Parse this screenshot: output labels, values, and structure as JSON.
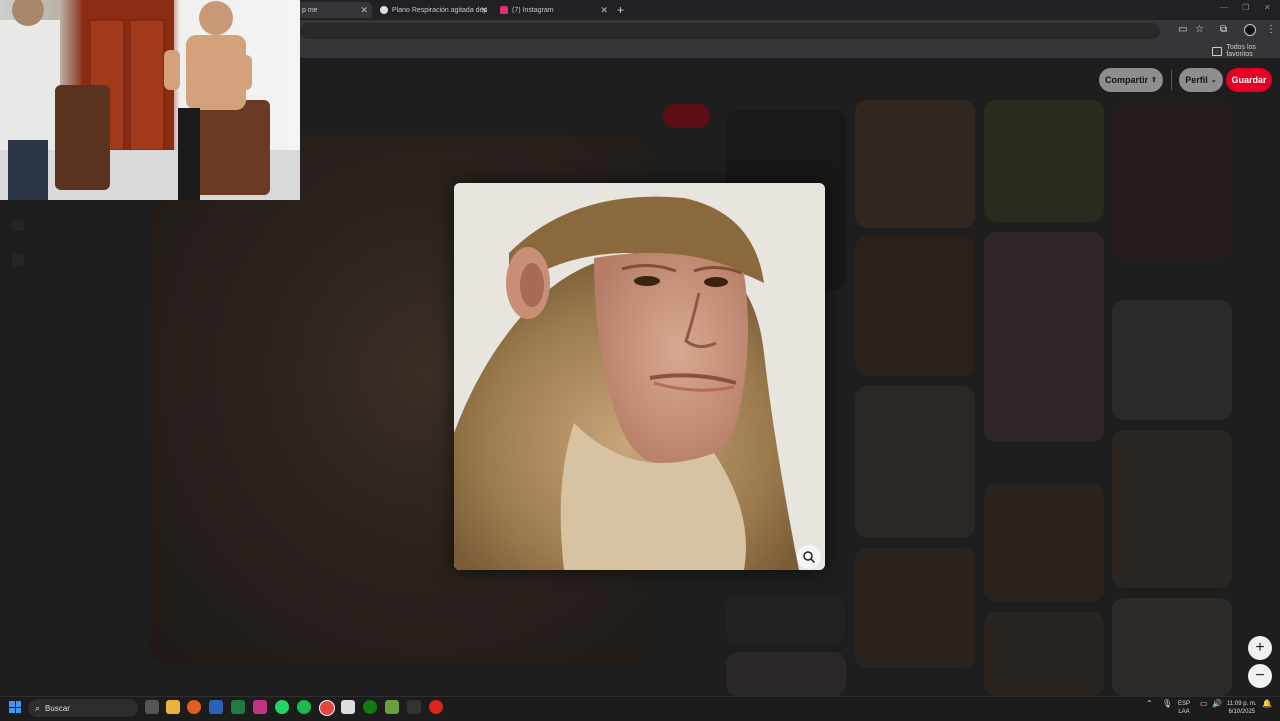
{
  "tabs": [
    {
      "label": "p me",
      "active": true
    },
    {
      "label": "Plano Respiración agitada dep",
      "active": false
    },
    {
      "label": "(7) Instagram",
      "active": false
    }
  ],
  "bookmarks": {
    "all_favorites": "Todos los favoritos"
  },
  "actions": {
    "share_label": "Compartir",
    "profile_label": "Perfil",
    "save_label": "Guardar"
  },
  "zoom": {
    "in_label": "+",
    "out_label": "−"
  },
  "taskbar": {
    "search_placeholder": "Buscar",
    "language_top": "ESP",
    "language_bottom": "LAA",
    "time": "11:09 p. m.",
    "date": "6/10/2025"
  },
  "colors": {
    "accent_red": "#e60023",
    "chrome_bg": "#202124"
  },
  "icons": [
    "windows-start-icon",
    "search-icon",
    "lens-search-icon",
    "zoom-in-icon",
    "zoom-out-icon",
    "star-icon",
    "extensions-icon"
  ]
}
